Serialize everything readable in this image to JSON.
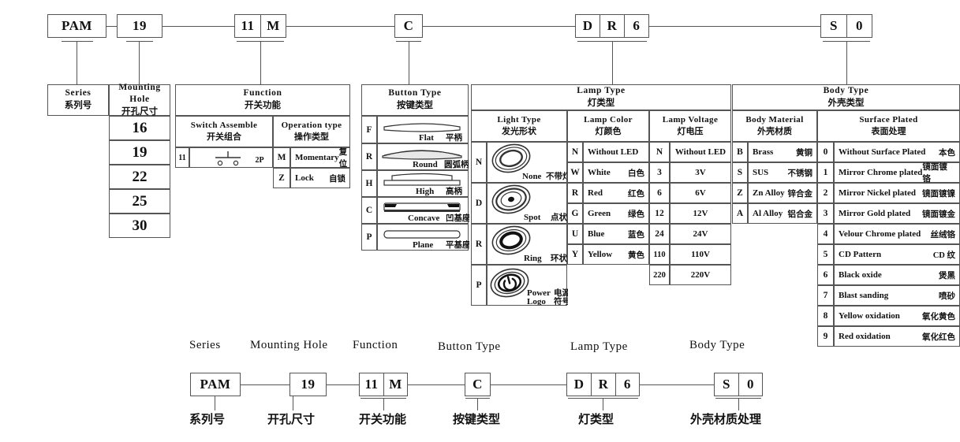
{
  "top_code": {
    "boxes": [
      {
        "name": "series",
        "cells": [
          "PAM"
        ]
      },
      {
        "name": "mounting-hole",
        "cells": [
          "19"
        ]
      },
      {
        "name": "function",
        "cells": [
          "11",
          "M"
        ]
      },
      {
        "name": "button-type",
        "cells": [
          "C"
        ]
      },
      {
        "name": "lamp-type",
        "cells": [
          "D",
          "R",
          "6"
        ]
      },
      {
        "name": "body-type",
        "cells": [
          "S",
          "0"
        ]
      }
    ]
  },
  "sections": {
    "series": {
      "en": "Series",
      "cn": "系列号"
    },
    "mounting_hole": {
      "en": "Mounting Hole",
      "cn": "开孔尺寸"
    },
    "function": {
      "en": "Function",
      "cn": "开关功能"
    },
    "button_type": {
      "en": "Button  Type",
      "cn": "按键类型"
    },
    "lamp_type": {
      "en": "Lamp  Type",
      "cn": "灯类型"
    },
    "body_type": {
      "en": "Body Type",
      "cn": "外壳类型"
    }
  },
  "mounting_hole_values": [
    "16",
    "19",
    "22",
    "25",
    "30"
  ],
  "switch_assemble": {
    "en": "Switch  Assemble",
    "cn": "开关组合",
    "left_code": "11",
    "right_code": "2P",
    "symbol": "push-button-no-symbol"
  },
  "operation_type": {
    "en": "Operation type",
    "cn": "操作类型",
    "rows": [
      {
        "code": "M",
        "en": "Momentary",
        "cn": "复位"
      },
      {
        "code": "Z",
        "en": "Lock",
        "cn": "自锁"
      }
    ]
  },
  "button_type_rows": [
    {
      "code": "F",
      "en": "Flat",
      "cn": "平柄",
      "icon": "button-flat-icon"
    },
    {
      "code": "R",
      "en": "Round",
      "cn": "圆弧柄",
      "icon": "button-round-icon"
    },
    {
      "code": "H",
      "en": "High",
      "cn": "高柄",
      "icon": "button-high-icon"
    },
    {
      "code": "C",
      "en": "Concave",
      "cn": "凹基座",
      "icon": "button-concave-icon"
    },
    {
      "code": "P",
      "en": "Plane",
      "cn": "平基座",
      "icon": "button-plane-icon"
    }
  ],
  "light_type": {
    "en": "Light Type",
    "cn": "发光形状",
    "rows": [
      {
        "code": "N",
        "en": "None",
        "cn": "不带灯",
        "icon": "lamp-none-icon"
      },
      {
        "code": "D",
        "en": "Spot",
        "cn": "点状",
        "icon": "lamp-spot-icon"
      },
      {
        "code": "R",
        "en": "Ring",
        "cn": "环状",
        "icon": "lamp-ring-icon"
      },
      {
        "code": "P",
        "en": "Power",
        "en2": "Logo",
        "cn": "电源",
        "cn2": "符号",
        "icon": "lamp-power-logo-icon"
      }
    ]
  },
  "lamp_color": {
    "en": "Lamp  Color",
    "cn": "灯颜色",
    "rows": [
      {
        "code": "N",
        "en": "Without LED",
        "cn": ""
      },
      {
        "code": "W",
        "en": "White",
        "cn": "白色"
      },
      {
        "code": "R",
        "en": "Red",
        "cn": "红色"
      },
      {
        "code": "G",
        "en": "Green",
        "cn": "绿色"
      },
      {
        "code": "U",
        "en": "Blue",
        "cn": "蓝色"
      },
      {
        "code": "Y",
        "en": "Yellow",
        "cn": "黄色"
      }
    ]
  },
  "lamp_voltage": {
    "en": "Lamp Voltage",
    "cn": "灯电压",
    "rows": [
      {
        "code": "N",
        "value": "Without LED"
      },
      {
        "code": "3",
        "value": "3V"
      },
      {
        "code": "6",
        "value": "6V"
      },
      {
        "code": "12",
        "value": "12V"
      },
      {
        "code": "24",
        "value": "24V"
      },
      {
        "code": "110",
        "value": "110V"
      },
      {
        "code": "220",
        "value": "220V"
      }
    ]
  },
  "body_material": {
    "en": "Body Material",
    "cn": "外壳材质",
    "rows": [
      {
        "code": "B",
        "en": "Brass",
        "cn": "黄铜"
      },
      {
        "code": "S",
        "en": "SUS",
        "cn": "不锈钢"
      },
      {
        "code": "Z",
        "en": "Zn Alloy",
        "cn": "锌合金"
      },
      {
        "code": "A",
        "en": "Al Alloy",
        "cn": "铝合金"
      }
    ]
  },
  "surface_plated": {
    "en": "Surface  Plated",
    "cn": "表面处理",
    "rows": [
      {
        "code": "0",
        "en": "Without Surface Plated",
        "cn": "本色"
      },
      {
        "code": "1",
        "en": "Mirror Chrome plated",
        "cn": "镜面镀铬"
      },
      {
        "code": "2",
        "en": "Mirror Nickel plated",
        "cn": "镜面镀镍"
      },
      {
        "code": "3",
        "en": "Mirror Gold plated",
        "cn": "镜面镀金"
      },
      {
        "code": "4",
        "en": "Velour Chrome plated",
        "cn": "丝绒铬"
      },
      {
        "code": "5",
        "en": "CD Pattern",
        "cn": "CD 纹"
      },
      {
        "code": "6",
        "en": "Black oxide",
        "cn": "煲黑"
      },
      {
        "code": "7",
        "en": "Blast sanding",
        "cn": "喷砂"
      },
      {
        "code": "8",
        "en": "Yellow oxidation",
        "cn": "氧化黄色"
      },
      {
        "code": "9",
        "en": "Red oxidation",
        "cn": "氧化红色"
      }
    ]
  },
  "summary": {
    "items": [
      {
        "en": "Series",
        "cells": [
          "PAM"
        ],
        "cn": "系列号"
      },
      {
        "en": "Mounting Hole",
        "cells": [
          "19"
        ],
        "cn": "开孔尺寸"
      },
      {
        "en": "Function",
        "cells": [
          "11",
          "M"
        ],
        "cn": "开关功能"
      },
      {
        "en": "Button  Type",
        "cells": [
          "C"
        ],
        "cn": "按键类型"
      },
      {
        "en": "Lamp  Type",
        "cells": [
          "D",
          "R",
          "6"
        ],
        "cn": "灯类型"
      },
      {
        "en": "Body Type",
        "cells": [
          "S",
          "0"
        ],
        "cn": "外壳材质处理"
      }
    ]
  }
}
